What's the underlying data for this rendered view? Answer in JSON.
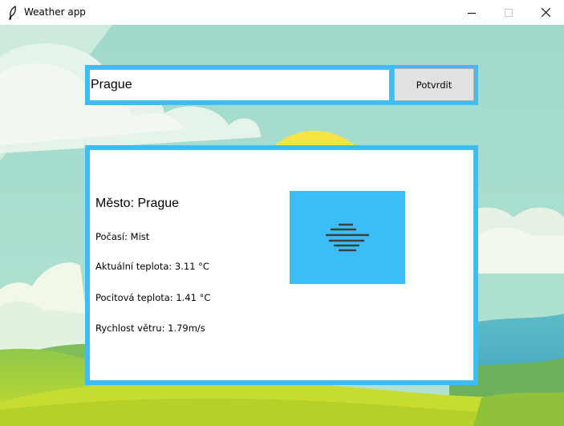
{
  "window": {
    "title": "Weather app",
    "minimize_icon": "minimize-icon",
    "maximize_icon": "maximize-icon",
    "close_icon": "close-icon"
  },
  "search": {
    "value": "Prague",
    "button_label": "Potvrdit"
  },
  "weather": {
    "city": "Město: Prague",
    "condition": "Počasí: Mist",
    "current_temp": "Aktuální teplota: 3.11 °C",
    "feels_like": "Pocitová teplota: 1.41 °C",
    "wind_speed": "Rychlost větru: 1.79m/s",
    "icon": "mist-icon"
  },
  "colors": {
    "accent": "#3dbdf5",
    "sky": "#a8dccc",
    "sun": "#f7e443",
    "hill": "#a9cc3b",
    "water": "#46aec3"
  }
}
